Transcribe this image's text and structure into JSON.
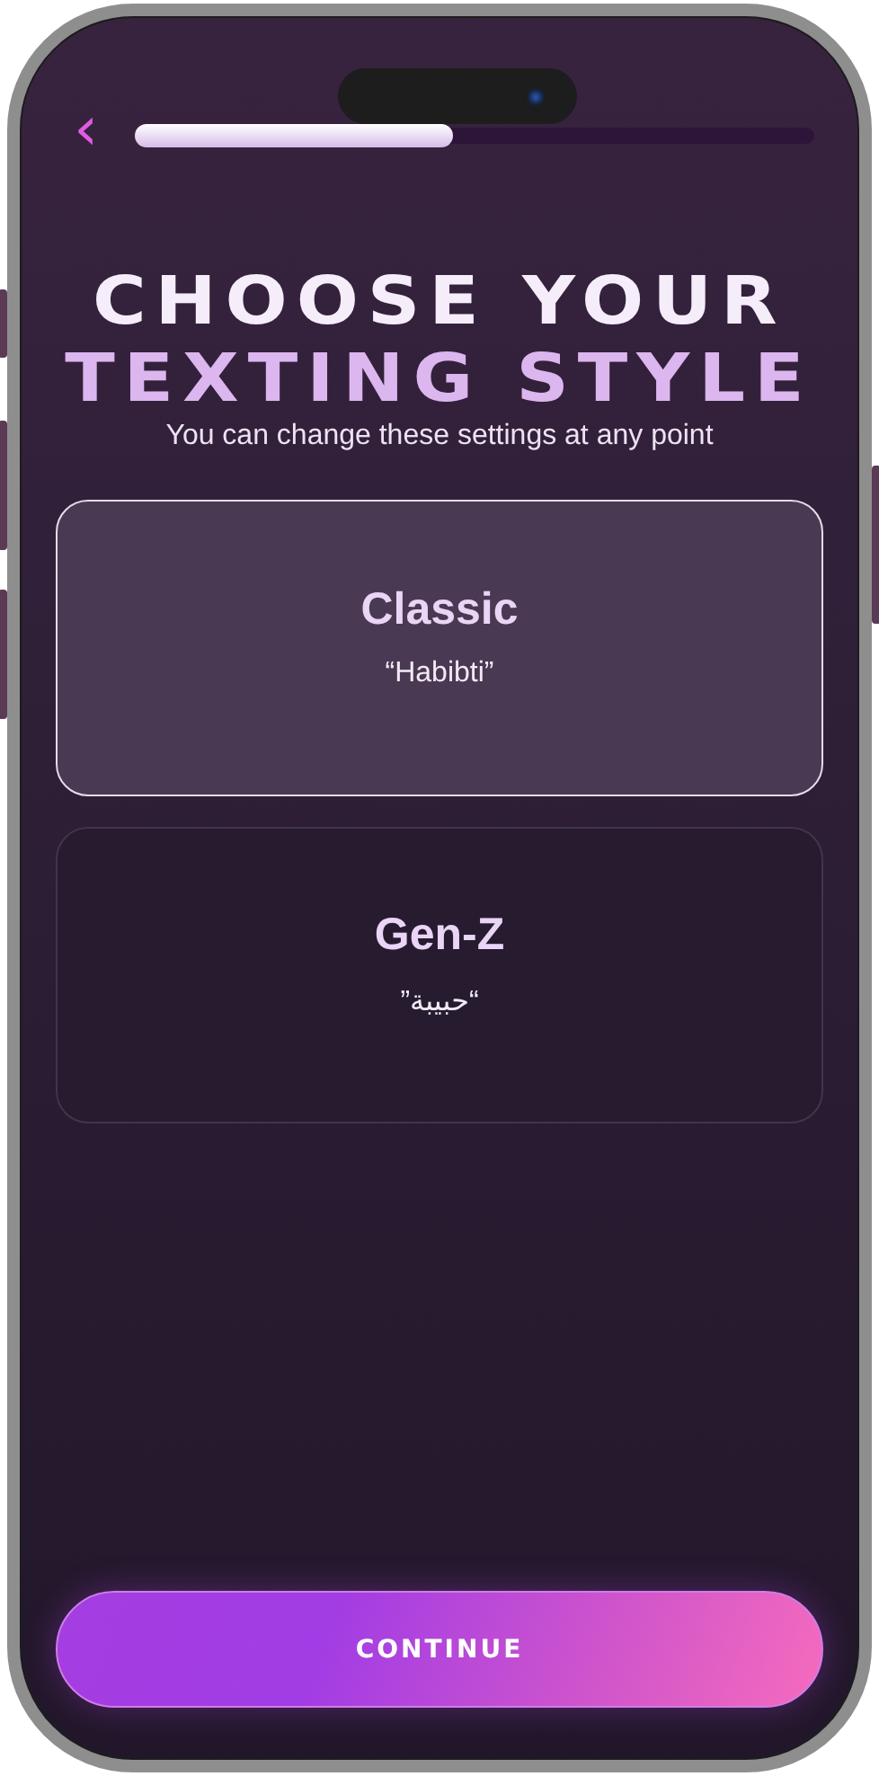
{
  "header": {
    "back_label": "‹",
    "progress": {
      "level": 0.47
    }
  },
  "title_lines": [
    "CHOOSE YOUR",
    "TEXTING STYLE"
  ],
  "subtitle": "You can change these settings at any point",
  "options": [
    {
      "title": "Classic",
      "example": "“Habibti”",
      "selected": true
    },
    {
      "title": "Gen-Z",
      "example": "“حبيبة”",
      "selected": false
    }
  ],
  "continue_button": "CONTINUE"
}
